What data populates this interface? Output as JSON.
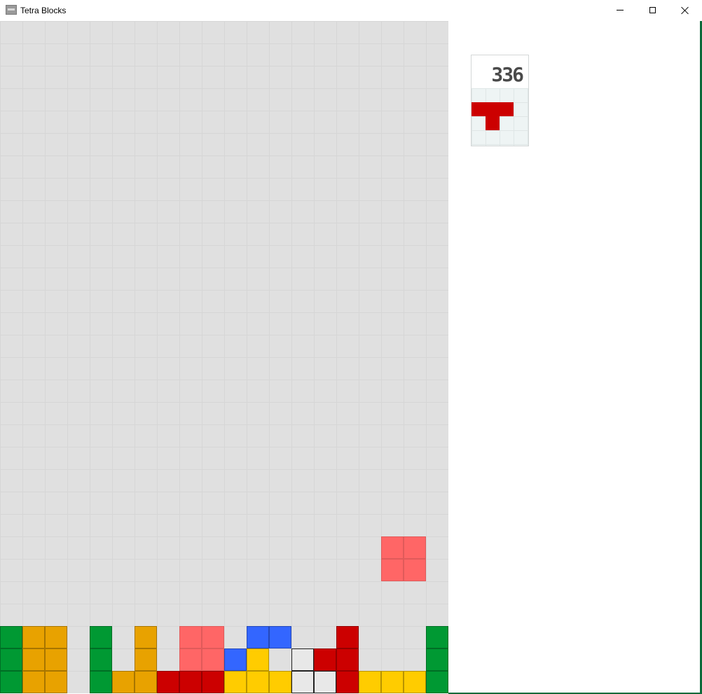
{
  "window": {
    "title": "Tetra Blocks",
    "controls": {
      "minimize_label": "Minimize",
      "maximize_label": "Maximize",
      "close_label": "Close"
    }
  },
  "colors": {
    "board_bg": "#e0e0e0",
    "grid_line": "#d6d6d6",
    "G": "#009933",
    "O": "#e8a200",
    "R": "#cc0000",
    "P": "#ff6666",
    "B": "#3366ff",
    "Y": "#ffcc00",
    "W": "#e8e8e8"
  },
  "board": {
    "columns": 20,
    "rows": 30,
    "active_piece": {
      "shape": "O",
      "color": "P",
      "cells": [
        [
          17,
          23
        ],
        [
          18,
          23
        ],
        [
          17,
          24
        ],
        [
          18,
          24
        ]
      ]
    },
    "stack_rows": {
      "27": "GOO.G.O.PP.BB..R...G",
      "28": "GOO.G.O.PPBY.WRR...G",
      "29": "GOO.GOORRRYYYWWRYYYG"
    }
  },
  "sidebar": {
    "score": "336",
    "next_piece": {
      "shape": "T",
      "color": "R",
      "cells": [
        [
          0,
          1
        ],
        [
          1,
          1
        ],
        [
          2,
          1
        ],
        [
          1,
          2
        ]
      ]
    }
  }
}
